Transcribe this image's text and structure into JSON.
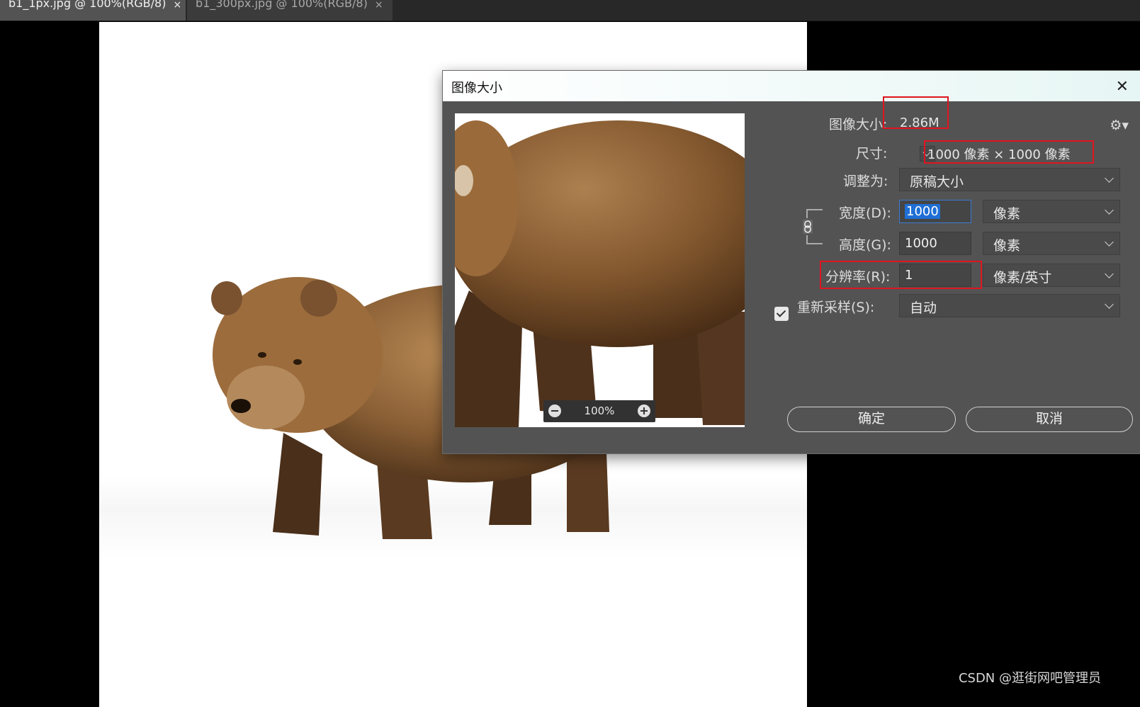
{
  "tabs": [
    {
      "label": "b1_1px.jpg @ 100%(RGB/8)",
      "close": "×"
    },
    {
      "label": "b1_300px.jpg @ 100%(RGB/8)",
      "close": "×"
    }
  ],
  "dialog": {
    "title": "图像大小",
    "close": "✕",
    "preview": {
      "zoom": "100%"
    },
    "image_size_label": "图像大小:",
    "image_size_value": "2.86M",
    "dimensions_label": "尺寸:",
    "dimensions_value": "1000 像素  ×  1000 像素",
    "fit_to_label": "调整为:",
    "fit_to_value": "原稿大小",
    "width_label": "宽度(D):",
    "width_value": "1000",
    "width_unit": "像素",
    "height_label": "高度(G):",
    "height_value": "1000",
    "height_unit": "像素",
    "resolution_label": "分辨率(R):",
    "resolution_value": "1",
    "resolution_unit": "像素/英寸",
    "resample_label": "重新采样(S):",
    "resample_checked": true,
    "resample_value": "自动",
    "ok_label": "确定",
    "cancel_label": "取消"
  },
  "watermark": "CSDN @逛街网吧管理员",
  "colors": {
    "highlight_box": "#e0141e",
    "dialog_bg": "#535353",
    "title_bg": "#e6f6f4",
    "selection": "#1f6fd6"
  }
}
